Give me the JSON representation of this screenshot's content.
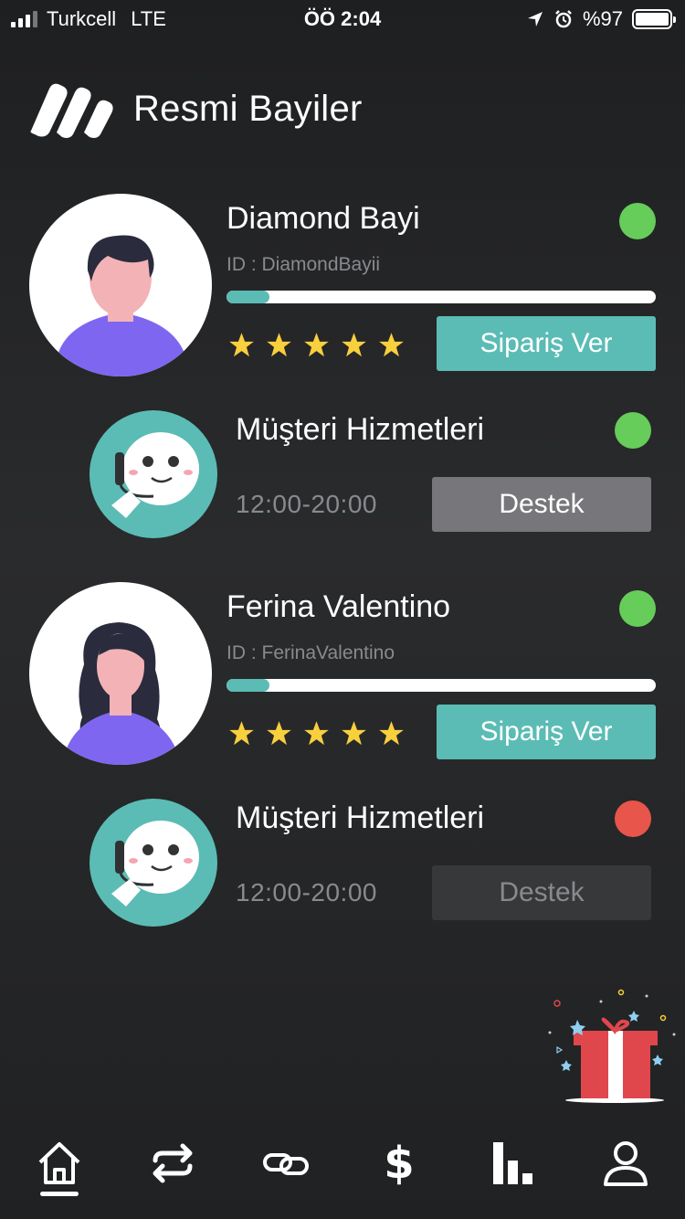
{
  "status_bar": {
    "carrier": "Turkcell",
    "network": "LTE",
    "time": "ÖÖ 2:04",
    "battery_percent": "%97",
    "icons": [
      "signal-icon",
      "location-arrow-icon",
      "alarm-icon",
      "battery-icon"
    ]
  },
  "header": {
    "title": "Resmi Bayiler",
    "logo_icon": "brand-logo-icon"
  },
  "dealers": [
    {
      "name": "Diamond Bayi",
      "id_text": "ID : DiamondBayii",
      "status_color": "#66cc5a",
      "progress": 0.1,
      "rating": 5,
      "order_label": "Sipariş Ver",
      "avatar": "male-avatar-icon",
      "support": {
        "title": "Müşteri Hizmetleri",
        "hours": "12:00-20:00",
        "button": "Destek",
        "status_color": "#66cc5a",
        "active": true
      }
    },
    {
      "name": "Ferina Valentino",
      "id_text": "ID : FerinaValentino",
      "status_color": "#66cc5a",
      "progress": 0.1,
      "rating": 5,
      "order_label": "Sipariş Ver",
      "avatar": "female-avatar-icon",
      "support": {
        "title": "Müşteri Hizmetleri",
        "hours": "12:00-20:00",
        "button": "Destek",
        "status_color": "#e8554a",
        "active": false
      }
    }
  ],
  "colors": {
    "accent": "#5bbcb5",
    "online": "#66cc5a",
    "offline": "#e8554a",
    "star": "#f8cf3c",
    "gift": "#e0474c"
  },
  "gift_icon": "gift-icon",
  "tab_bar": {
    "tabs": [
      "home-icon",
      "transfer-icon",
      "link-icon",
      "dollar-icon",
      "stats-icon",
      "profile-icon"
    ],
    "active": 0,
    "dollar_glyph": "$"
  }
}
